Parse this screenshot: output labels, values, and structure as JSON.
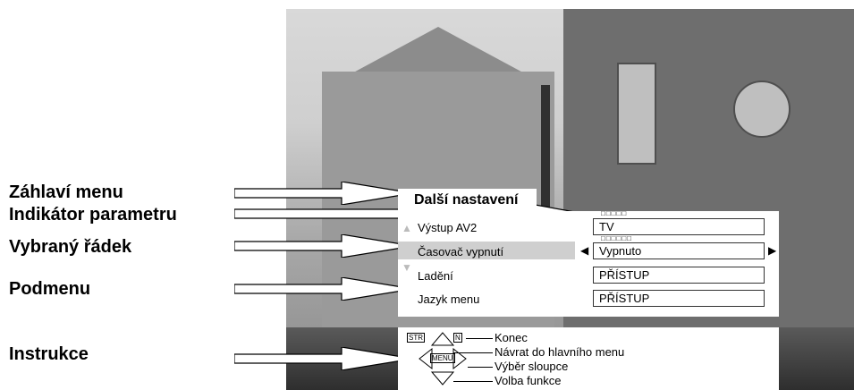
{
  "labels": {
    "header": "Záhlaví menu",
    "param_indicator": "Indikátor parametru",
    "selected_row": "Vybraný řádek",
    "submenu": "Podmenu",
    "instructions": "Instrukce"
  },
  "menu": {
    "title": "Další nastavení",
    "rows": [
      {
        "name": "Výstup AV2",
        "value": "TV"
      },
      {
        "name": "Časovač vypnutí",
        "value": "Vypnuto"
      },
      {
        "name": "Ladění",
        "value": "PŘÍSTUP"
      },
      {
        "name": "Jazyk menu",
        "value": "PŘÍSTUP"
      }
    ],
    "param_indicators": {
      "row1": "□□□□□",
      "row2": "□□□□□□"
    }
  },
  "instructions": {
    "exit": "Konec",
    "return": "Návrat do hlavního menu",
    "select_column": "Výběr sloupce",
    "select_function": "Volba funkce",
    "key_menu": "MENU",
    "key_left": "STR",
    "key_right": "N"
  }
}
